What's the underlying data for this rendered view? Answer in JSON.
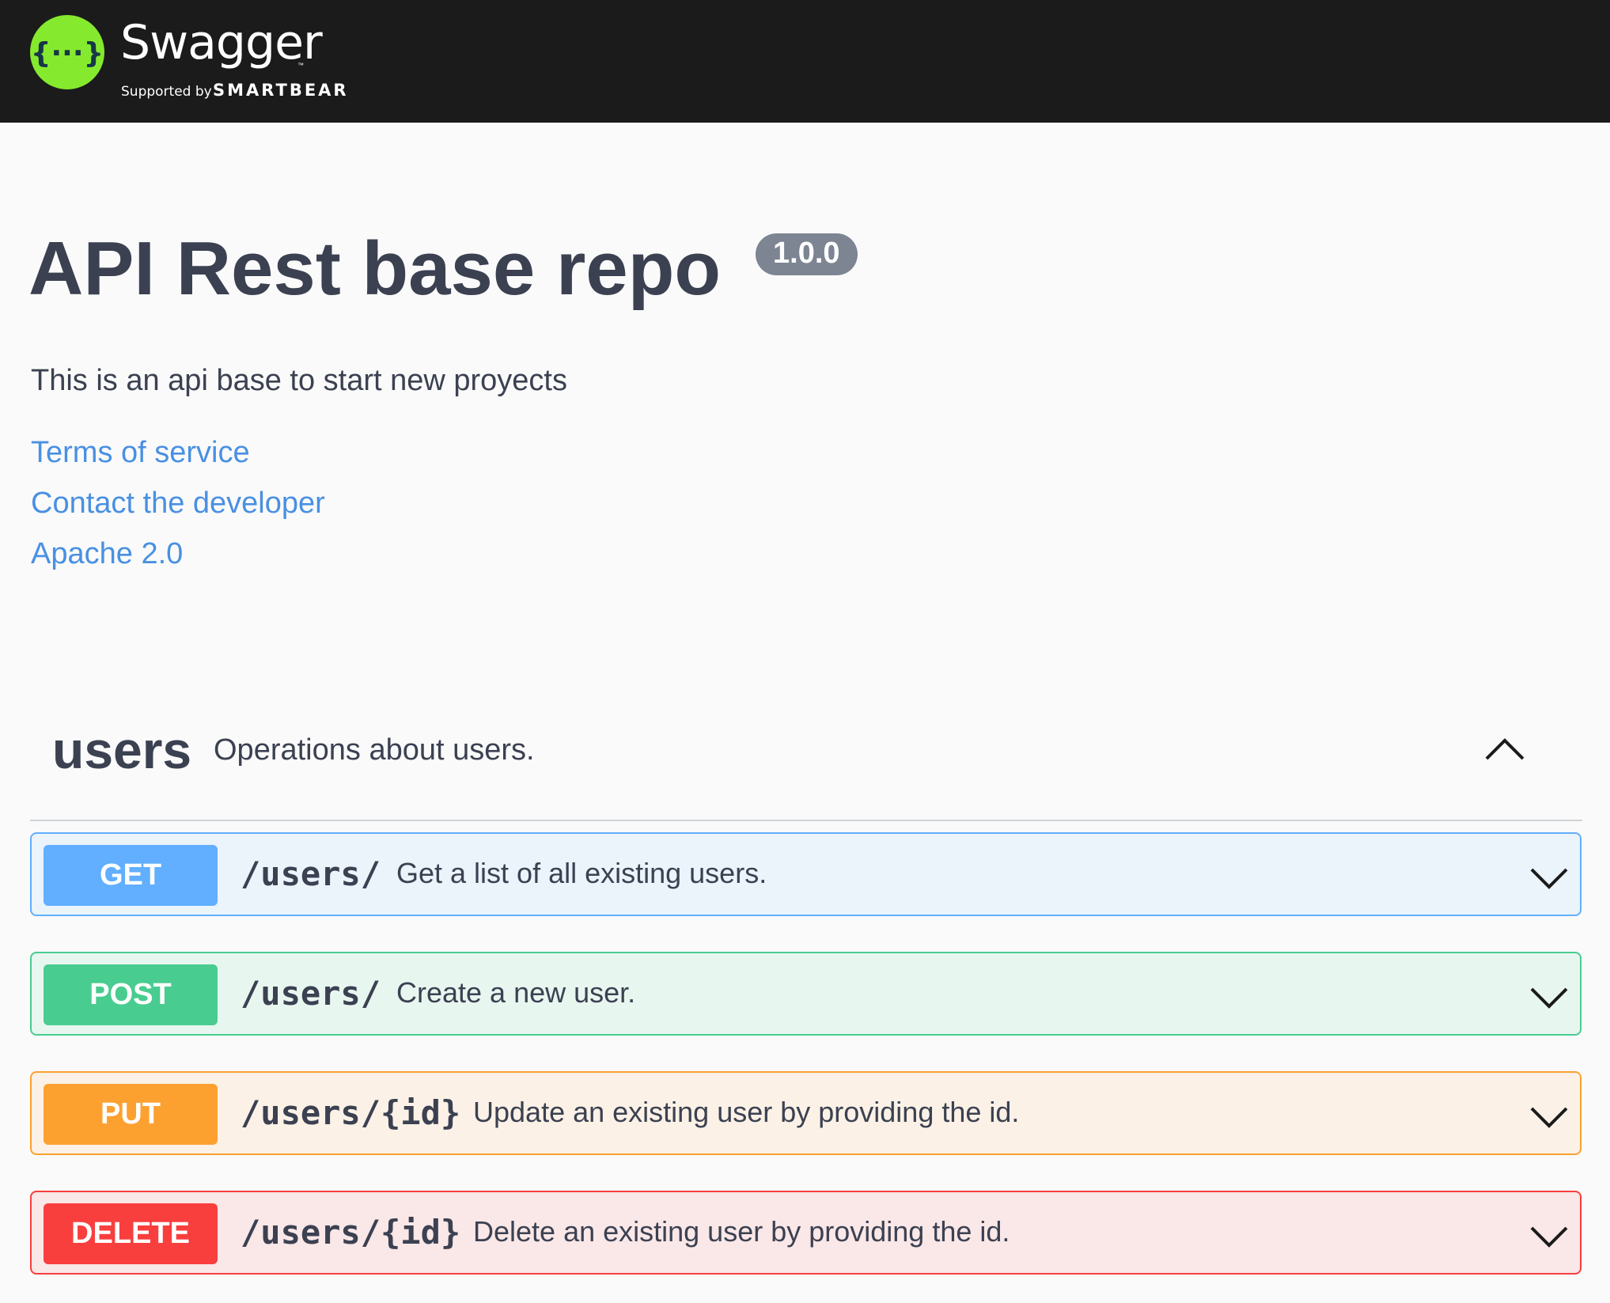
{
  "header": {
    "logo_name": "Swagger",
    "logo_tm": "™",
    "supported_by": "Supported by",
    "company": "SMARTBEAR",
    "logo_color": "#85ea2d",
    "logo_glyph": "{···}"
  },
  "info": {
    "title": "API Rest base repo",
    "version": "1.0.0",
    "description": "This is an api base to start new proyects",
    "links": [
      {
        "label": "Terms of service"
      },
      {
        "label": "Contact the developer"
      },
      {
        "label": "Apache 2.0"
      }
    ]
  },
  "tag": {
    "name": "users",
    "description": "Operations about users.",
    "state": "expanded",
    "icon": "chevron-up-icon"
  },
  "operations": [
    {
      "method": "GET",
      "path": "/users/",
      "summary": "Get a list of all existing users.",
      "color": "#61affe",
      "bg": "#ebf3fb",
      "icon": "chevron-down-icon"
    },
    {
      "method": "POST",
      "path": "/users/",
      "summary": "Create a new user.",
      "color": "#49cc90",
      "bg": "#e8f6f0",
      "icon": "chevron-down-icon"
    },
    {
      "method": "PUT",
      "path": "/users/{id}",
      "summary": "Update an existing user by providing the id.",
      "color": "#fca130",
      "bg": "#fbf1e6",
      "icon": "chevron-down-icon"
    },
    {
      "method": "DELETE",
      "path": "/users/{id}",
      "summary": "Delete an existing user by providing the id.",
      "color": "#f93e3e",
      "bg": "#fae7e7",
      "icon": "chevron-down-icon"
    }
  ]
}
